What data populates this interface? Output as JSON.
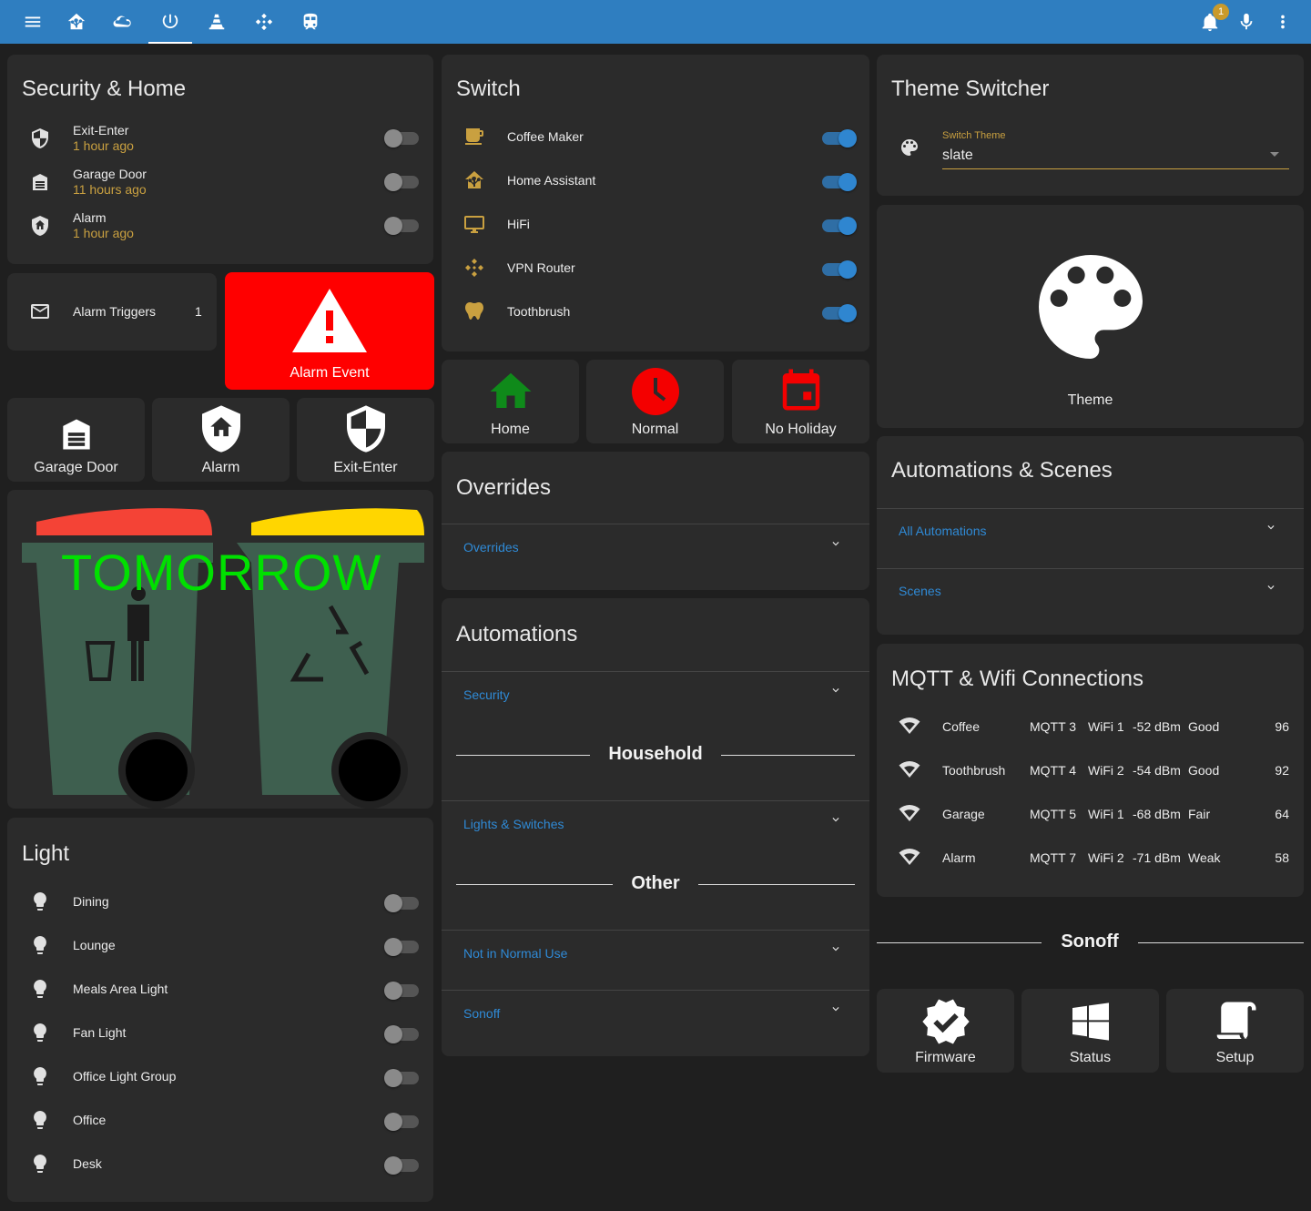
{
  "topbar": {
    "tabs": [
      "menu-icon",
      "home-assistant-icon",
      "cloud-icon",
      "power-icon",
      "vlc-cone-icon",
      "kodi-icon",
      "train-icon"
    ],
    "notification_count": "1"
  },
  "security": {
    "title": "Security & Home",
    "items": [
      {
        "name": "Exit-Enter",
        "time": "1 hour ago",
        "on": false
      },
      {
        "name": "Garage Door",
        "time": "11 hours ago",
        "on": false
      },
      {
        "name": "Alarm",
        "time": "1 hour ago",
        "on": false
      }
    ]
  },
  "alarm_triggers": {
    "label": "Alarm Triggers",
    "value": "1"
  },
  "alarm_event": {
    "label": "Alarm Event",
    "bg": "#ff0000"
  },
  "security_buttons": [
    "Garage Door",
    "Alarm",
    "Exit-Enter"
  ],
  "bins": {
    "text": "TOMORROW",
    "text_color": "#00e000",
    "left_lid": "#f44336",
    "right_lid": "#ffd600",
    "bin_color": "#3e5f4f"
  },
  "light": {
    "title": "Light",
    "items": [
      "Dining",
      "Lounge",
      "Meals Area Light",
      "Fan Light",
      "Office Light Group",
      "Office",
      "Desk"
    ]
  },
  "switch": {
    "title": "Switch",
    "items": [
      {
        "name": "Coffee Maker",
        "icon": "coffee-icon"
      },
      {
        "name": "Home Assistant",
        "icon": "home-assistant-icon"
      },
      {
        "name": "HiFi",
        "icon": "monitor-icon"
      },
      {
        "name": "VPN Router",
        "icon": "kodi-icon"
      },
      {
        "name": "Toothbrush",
        "icon": "tooth-icon"
      }
    ]
  },
  "mode_buttons": [
    {
      "label": "Home",
      "icon": "home-icon",
      "color": "#0f8a1a"
    },
    {
      "label": "Normal",
      "icon": "clock-icon",
      "color": "#f40000"
    },
    {
      "label": "No Holiday",
      "icon": "calendar-icon",
      "color": "#f40000"
    }
  ],
  "overrides": {
    "title": "Overrides",
    "sections": [
      "Overrides"
    ]
  },
  "automations": {
    "title": "Automations",
    "security": "Security",
    "household": "Household",
    "lights": "Lights & Switches",
    "other": "Other",
    "not_normal": "Not in Normal Use",
    "sonoff": "Sonoff"
  },
  "theme": {
    "title": "Theme Switcher",
    "field_label": "Switch Theme",
    "value": "slate",
    "button_label": "Theme"
  },
  "auto_scenes": {
    "title": "Automations & Scenes",
    "sections": [
      "All Automations",
      "Scenes"
    ]
  },
  "mqtt": {
    "title": "MQTT & Wifi Connections",
    "rows": [
      {
        "name": "Coffee",
        "mqtt": "MQTT 3",
        "wifi": "WiFi 1",
        "dbm": "-52 dBm",
        "quality": "Good",
        "pct": "96"
      },
      {
        "name": "Toothbrush",
        "mqtt": "MQTT 4",
        "wifi": "WiFi 2",
        "dbm": "-54 dBm",
        "quality": "Good",
        "pct": "92"
      },
      {
        "name": "Garage",
        "mqtt": "MQTT 5",
        "wifi": "WiFi 1",
        "dbm": "-68 dBm",
        "quality": "Fair",
        "pct": "64"
      },
      {
        "name": "Alarm",
        "mqtt": "MQTT 7",
        "wifi": "WiFi 2",
        "dbm": "-71 dBm",
        "quality": "Weak",
        "pct": "58"
      }
    ]
  },
  "sonoff": {
    "title": "Sonoff",
    "buttons": [
      "Firmware",
      "Status",
      "Setup"
    ]
  }
}
